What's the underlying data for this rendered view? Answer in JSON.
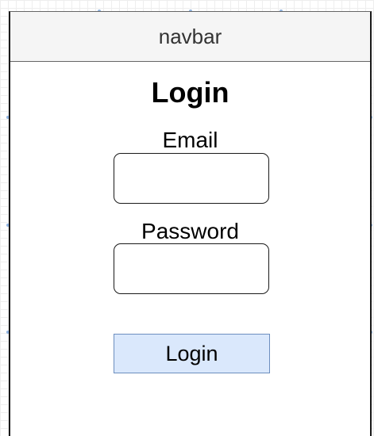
{
  "navbar": {
    "label": "navbar"
  },
  "form": {
    "title": "Login",
    "email_label": "Email",
    "email_value": "",
    "password_label": "Password",
    "password_value": "",
    "submit_label": "Login"
  },
  "colors": {
    "navbar_bg": "#f5f5f5",
    "button_fill": "#dae8fc",
    "button_border": "#6c8ebf",
    "frame_border": "#1a1a1a"
  }
}
